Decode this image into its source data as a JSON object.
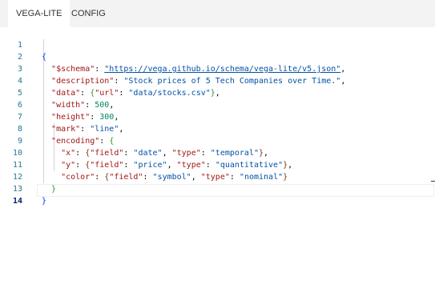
{
  "tabs": [
    {
      "label": "VEGA-LITE",
      "active": true
    },
    {
      "label": "CONFIG",
      "active": false
    }
  ],
  "editor": {
    "line_numbers": [
      "1",
      "2",
      "3",
      "4",
      "5",
      "6",
      "7",
      "8",
      "9",
      "10",
      "11",
      "12",
      "13",
      "14"
    ],
    "current_line": "14",
    "code": {
      "open_brace": "{",
      "schema_key": "\"$schema\"",
      "schema_value": "\"https://vega.github.io/schema/vega-lite/v5.json\"",
      "description_key": "\"description\"",
      "description_value": "\"Stock prices of 5 Tech Companies over Time.\"",
      "data_key": "\"data\"",
      "url_key": "\"url\"",
      "url_value": "\"data/stocks.csv\"",
      "width_key": "\"width\"",
      "width_value": "500",
      "height_key": "\"height\"",
      "height_value": "300",
      "mark_key": "\"mark\"",
      "mark_value": "\"line\"",
      "encoding_key": "\"encoding\"",
      "x_key": "\"x\"",
      "x_field_key": "\"field\"",
      "x_field_value": "\"date\"",
      "x_type_key": "\"type\"",
      "x_type_value": "\"temporal\"",
      "y_key": "\"y\"",
      "y_field_key": "\"field\"",
      "y_field_value": "\"price\"",
      "y_type_key": "\"type\"",
      "y_type_value": "\"quantitative\"",
      "color_key": "\"color\"",
      "color_field_key": "\"field\"",
      "color_field_value": "\"symbol\"",
      "color_type_key": "\"type\"",
      "color_type_value": "\"nominal\"",
      "close_brace": "}"
    }
  },
  "colors": {
    "key": "#a31515",
    "string": "#0451a5",
    "number": "#098658",
    "line_number": "#237893",
    "bracket_level_1": "#0431fa",
    "bracket_level_2": "#319331",
    "bracket_level_3": "#7b3814"
  }
}
